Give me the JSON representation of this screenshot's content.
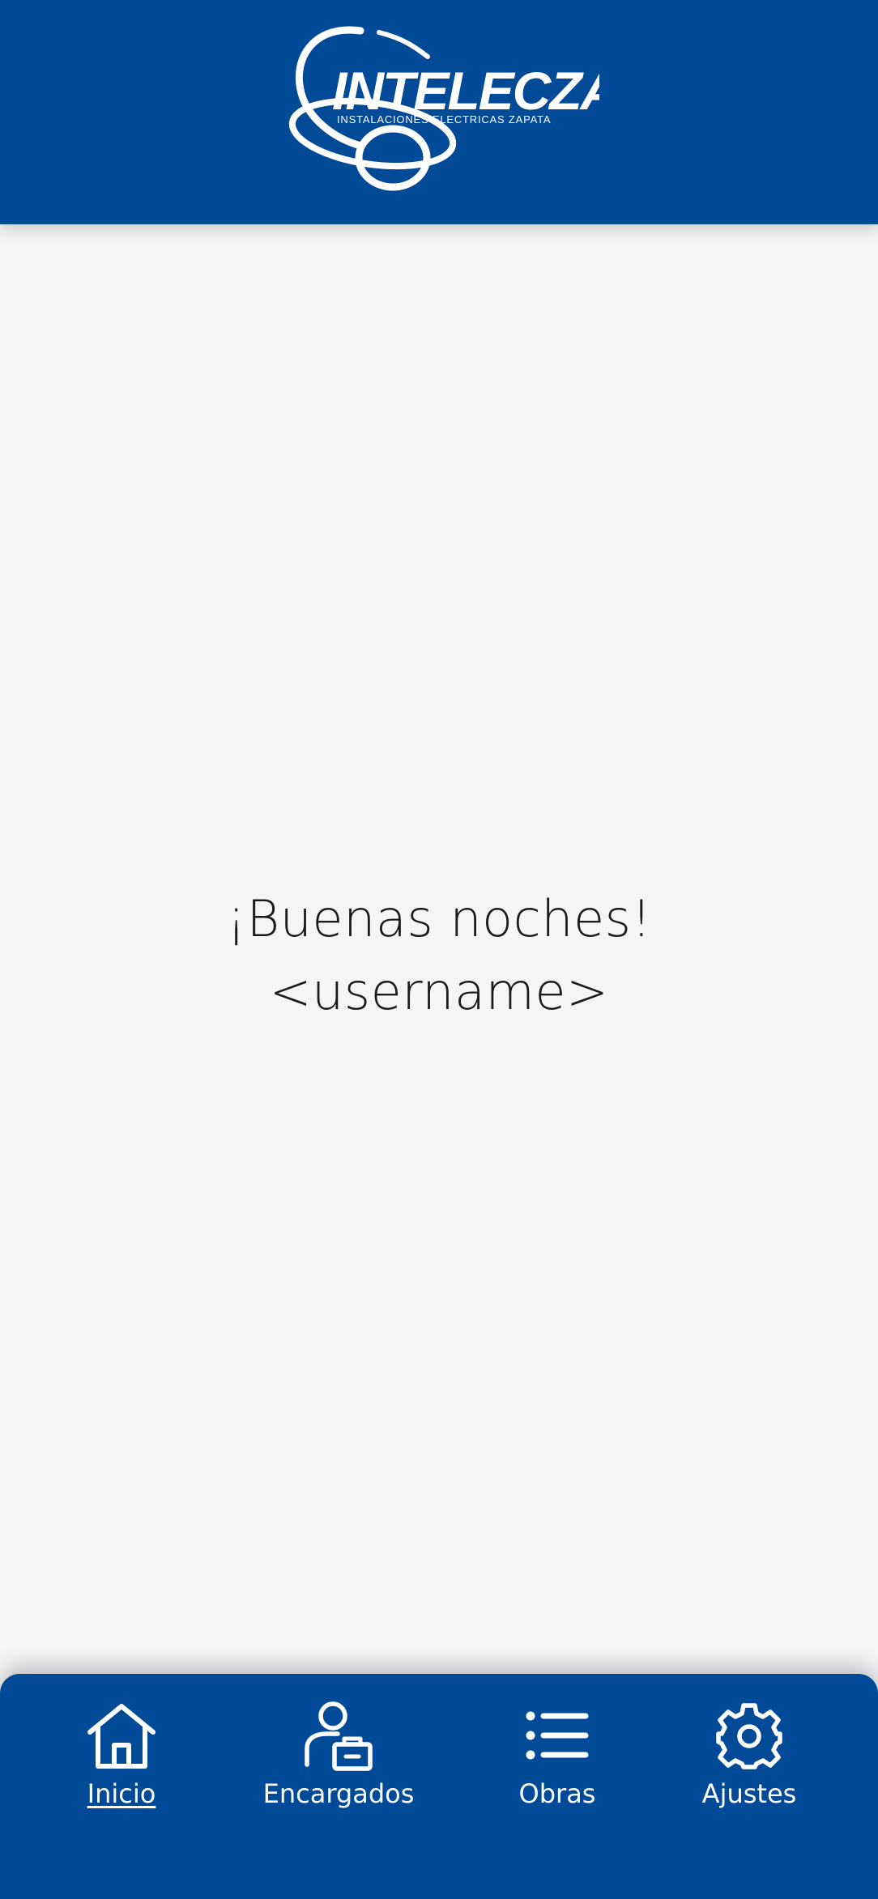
{
  "header": {
    "brand_name": "INTELECZA",
    "brand_tagline": "INSTALACIONES ELECTRICAS ZAPATA",
    "background_color": "#004a97"
  },
  "main": {
    "greeting": "¡Buenas noches!",
    "username": "<username>"
  },
  "bottom_nav": {
    "items": [
      {
        "label": "Inicio",
        "icon": "home-icon",
        "active": true
      },
      {
        "label": "Encargados",
        "icon": "person-badge-icon",
        "active": false
      },
      {
        "label": "Obras",
        "icon": "list-icon",
        "active": false
      },
      {
        "label": "Ajustes",
        "icon": "gear-icon",
        "active": false
      }
    ]
  },
  "colors": {
    "brand_blue": "#004a97",
    "page_background": "#f5f5f7",
    "text_dark": "#1b1b1b",
    "text_light": "#ffffff"
  }
}
